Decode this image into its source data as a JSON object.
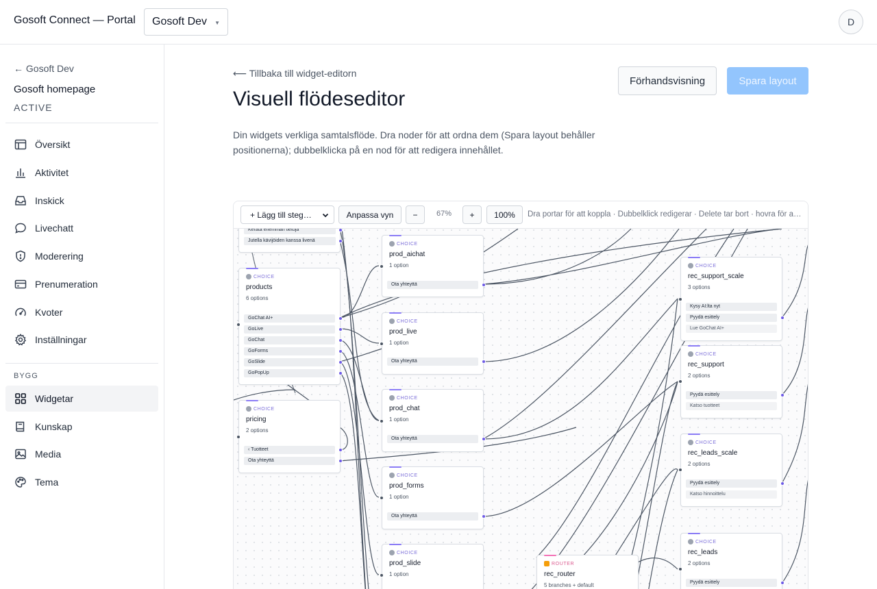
{
  "app": {
    "title": "Gosoft Connect — Portal",
    "workspace": "Gosoft Dev",
    "avatar_initial": "D"
  },
  "sidebar": {
    "back_label": "← Gosoft Dev",
    "site_name": "Gosoft homepage",
    "site_status": "ACTIVE",
    "items": [
      {
        "label": "Översikt",
        "icon": "table-icon"
      },
      {
        "label": "Aktivitet",
        "icon": "bar-chart-icon"
      },
      {
        "label": "Inskick",
        "icon": "inbox-icon"
      },
      {
        "label": "Livechatt",
        "icon": "chat-bubble-icon"
      },
      {
        "label": "Moderering",
        "icon": "shield-icon"
      },
      {
        "label": "Prenumeration",
        "icon": "credit-card-icon"
      },
      {
        "label": "Kvoter",
        "icon": "gauge-icon"
      },
      {
        "label": "Inställningar",
        "icon": "gear-icon"
      }
    ],
    "section_label": "BYGG",
    "build_items": [
      {
        "label": "Widgetar",
        "icon": "grid-icon",
        "active": true
      },
      {
        "label": "Kunskap",
        "icon": "book-icon"
      },
      {
        "label": "Media",
        "icon": "image-icon"
      },
      {
        "label": "Tema",
        "icon": "palette-icon"
      }
    ]
  },
  "main": {
    "breadcrumb": "⟵ Tillbaka till widget-editorn",
    "title": "Visuell flödeseditor",
    "description": "Din widgets verkliga samtalsflöde. Dra noder för att ordna dem (Spara layout behåller positionerna); dubbelklicka på en nod för att redigera innehållet.",
    "preview_label": "Förhandsvisning",
    "save_label": "Spara layout"
  },
  "toolbar": {
    "add_step": "+ Lägg till steg…",
    "fit_view": "Anpassa vyn",
    "zoom_out": "−",
    "zoom_level": "67%",
    "zoom_in": "+",
    "zoom_reset": "100%",
    "hint": "Dra portar för att koppla · Dubbelklick redigerar · Delete tar bort · hovra för att visa"
  },
  "nodes": {
    "top": {
      "opts": [
        "Kerätä enemmän tietoja",
        "Jutella kävijöiden kanssa livenä"
      ]
    },
    "products": {
      "type": "CHOICE",
      "name": "products",
      "sub": "6 options",
      "opts": [
        "GoChat AI+",
        "GoLive",
        "GoChat",
        "GoForms",
        "GoSlide",
        "GoPopUp"
      ]
    },
    "pricing": {
      "type": "CHOICE",
      "name": "pricing",
      "sub": "2 options",
      "opts": [
        "‹ Tuotteet",
        "Ota yhteyttä"
      ]
    },
    "prod_aichat": {
      "type": "CHOICE",
      "name": "prod_aichat",
      "sub": "1 option",
      "opts": [
        "Ota yhteyttä"
      ]
    },
    "prod_live": {
      "type": "CHOICE",
      "name": "prod_live",
      "sub": "1 option",
      "opts": [
        "Ota yhteyttä"
      ]
    },
    "prod_chat": {
      "type": "CHOICE",
      "name": "prod_chat",
      "sub": "1 option",
      "opts": [
        "Ota yhteyttä"
      ]
    },
    "prod_forms": {
      "type": "CHOICE",
      "name": "prod_forms",
      "sub": "1 option",
      "opts": [
        "Ota yhteyttä"
      ]
    },
    "prod_slide": {
      "type": "CHOICE",
      "name": "prod_slide",
      "sub": "1 option"
    },
    "rec_router": {
      "type": "ROUTER",
      "name": "rec_router",
      "sub": "5 branches + default"
    },
    "rec_support_scale": {
      "type": "CHOICE",
      "name": "rec_support_scale",
      "sub": "3 options",
      "opts": [
        "Kysy AI:lta nyt",
        "Pyydä esittely",
        "Lue GoChat AI+"
      ]
    },
    "rec_support": {
      "type": "CHOICE",
      "name": "rec_support",
      "sub": "2 options",
      "opts": [
        "Pyydä esittely",
        "Katso tuotteet"
      ]
    },
    "rec_leads_scale": {
      "type": "CHOICE",
      "name": "rec_leads_scale",
      "sub": "2 options",
      "opts": [
        "Pyydä esittely",
        "Katso hinnoittelu"
      ]
    },
    "rec_leads": {
      "type": "CHOICE",
      "name": "rec_leads",
      "sub": "2 options",
      "opts": [
        "Pyydä esittely"
      ]
    }
  }
}
